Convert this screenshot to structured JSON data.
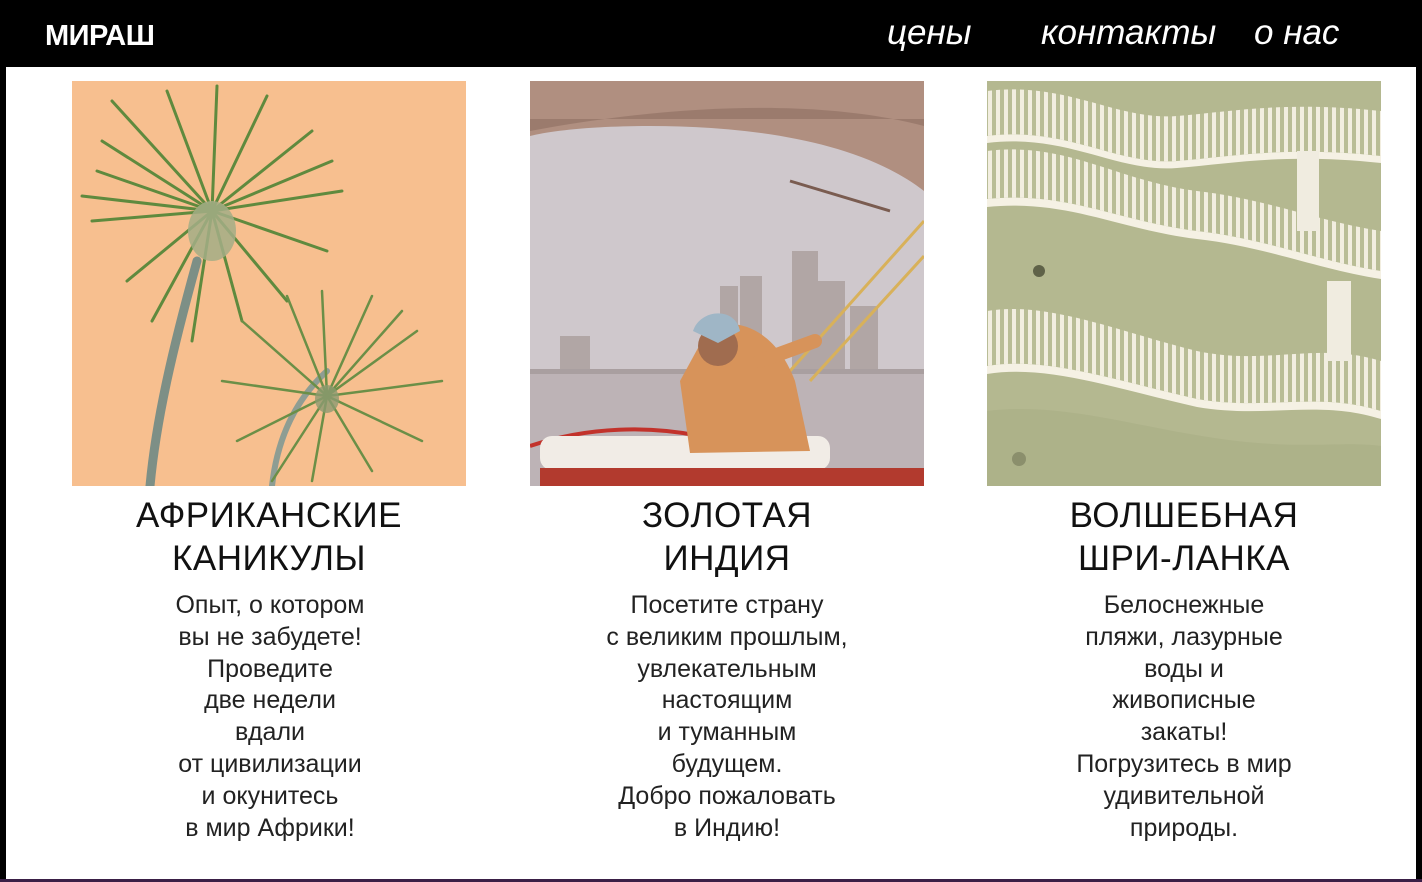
{
  "header": {
    "logo": "МИРАШ",
    "nav": {
      "prices": "цены",
      "contacts": "контакты",
      "about": "о нас"
    }
  },
  "cards": [
    {
      "title_line1": "АФРИКАНСКИЕ",
      "title_line2": "КАНИКУЛЫ",
      "text": "Опыт, о котором\n вы не забудете!\nПроведите\nдве недели\nвдали\nот цивилизации\nи окунитесь\nв мир Африки!",
      "photo": "palm-trees-photo"
    },
    {
      "title_line1": "ЗОЛОТАЯ",
      "title_line2": "ИНДИЯ",
      "text": "Посетите страну\nс великим прошлым,\nувлекательным\nнастоящим\nи туманным\nбудущем.\nДобро пожаловать\nв Индию!",
      "photo": "boatman-river-photo"
    },
    {
      "title_line1": "ВОЛШЕБНАЯ",
      "title_line2": "ШРИ-ЛАНКА",
      "text": "Белоснежные\nпляжи, лазурные\nводы  и\nживописные\nзакаты!\nПогрузитесь в мир\nудивительной\nприроды.",
      "photo": "wavy-balconies-photo"
    }
  ],
  "colors": {
    "header_bg": "#000000",
    "peach": "#f7bf8f",
    "balcony_green": "#b9bd96"
  }
}
